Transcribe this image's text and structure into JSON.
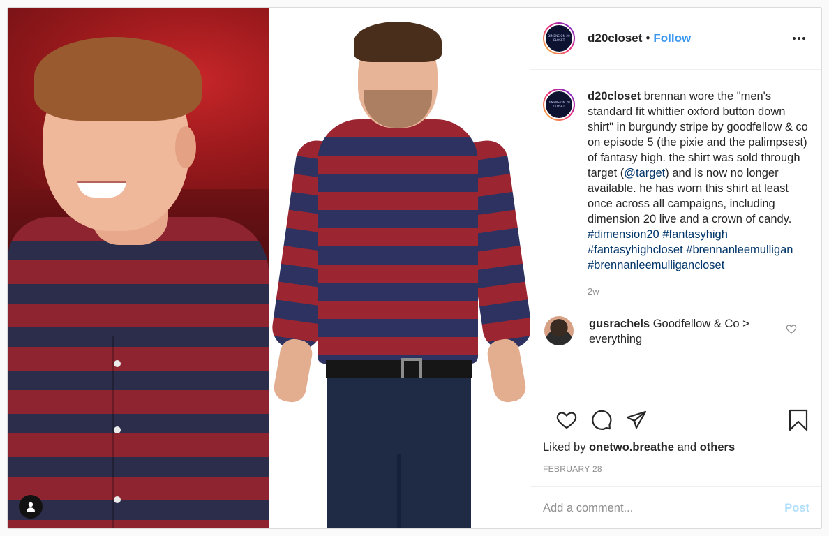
{
  "post": {
    "username": "d20closet",
    "separator": "•",
    "follow_label": "Follow",
    "avatar_logo_text": "DIMENSION 20 CLOSET",
    "caption": {
      "username": "d20closet",
      "text_1": " brennan wore the \"men's standard fit whittier oxford button down shirt\" in burgundy stripe by goodfellow & co on episode 5 (the pixie and the palimpsest) of fantasy high. the shirt was sold through target (",
      "mention": "@target",
      "text_2": ") and is now no longer available. he has worn this shirt at least once across all campaigns, including dimension 20 live and a crown of candy. ",
      "hashtags": [
        "#dimension20",
        "#fantasyhigh",
        "#fantasyhighcloset",
        "#brennanleemulligan",
        "#brennanleemulligancloset"
      ],
      "time": "2w"
    },
    "comments": [
      {
        "username": "gusrachels",
        "text": " Goodfellow & Co > everything"
      }
    ],
    "likes": {
      "prefix": "Liked by ",
      "user": "onetwo.breathe",
      "middle": " and ",
      "others": "others"
    },
    "date": "FEBRUARY 28",
    "add_comment_placeholder": "Add a comment...",
    "post_label": "Post"
  },
  "icons": {
    "more": "more-options-icon",
    "like": "heart-icon",
    "comment": "comment-icon",
    "share": "share-icon",
    "save": "bookmark-icon",
    "user_tag": "user-tag-icon"
  },
  "colors": {
    "link": "#003569",
    "follow": "#3897f0",
    "post_disabled": "#b2dffc",
    "muted": "#8e8e8e"
  }
}
